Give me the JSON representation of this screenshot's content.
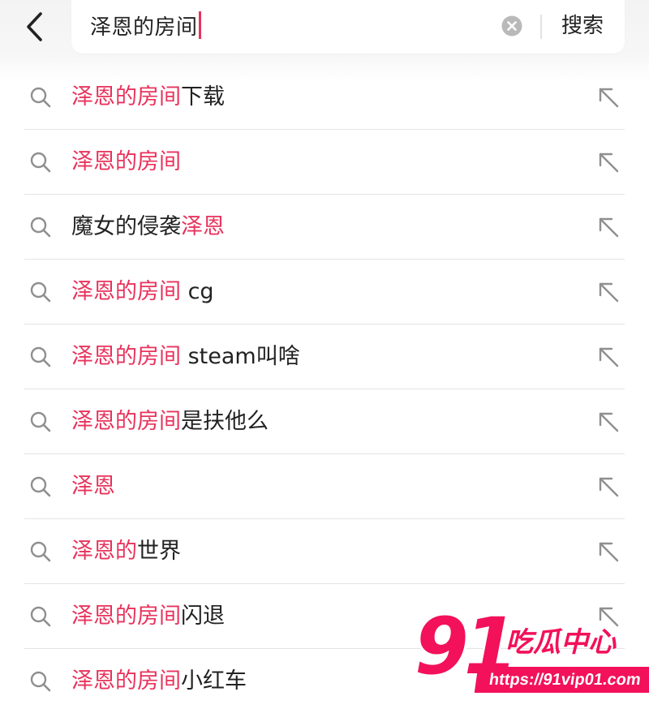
{
  "header": {
    "back_icon": "chevron-left-icon",
    "search": {
      "value": "泽恩的房间",
      "clear_icon": "clear-circle-icon"
    },
    "search_button_label": "搜索"
  },
  "colors": {
    "highlight": "#e8335c",
    "text": "#222222",
    "icon": "#8f8f8f",
    "watermark": "#f2115a"
  },
  "suggestions": [
    {
      "highlight": "泽恩的房间",
      "rest": "下载",
      "prefix": ""
    },
    {
      "highlight": "泽恩的房间",
      "rest": "",
      "prefix": ""
    },
    {
      "prefix": "魔女的侵袭",
      "highlight": "泽恩",
      "rest": ""
    },
    {
      "highlight": "泽恩的房间",
      "rest": " cg",
      "prefix": ""
    },
    {
      "highlight": "泽恩的房间",
      "rest": " steam叫啥",
      "prefix": ""
    },
    {
      "highlight": "泽恩的房间",
      "rest": "是扶他么",
      "prefix": ""
    },
    {
      "highlight": "泽恩",
      "rest": "",
      "prefix": ""
    },
    {
      "highlight": "泽恩的",
      "rest": "世界",
      "prefix": ""
    },
    {
      "highlight": "泽恩的房间",
      "rest": "闪退",
      "prefix": ""
    },
    {
      "highlight": "泽恩的房间",
      "rest": "小红车",
      "prefix": ""
    }
  ],
  "row_icons": {
    "leading": "search-icon",
    "trailing": "fill-query-arrow-icon"
  },
  "watermark": {
    "number": "91",
    "title": "吃瓜中心",
    "url": "https://91vip01.com"
  }
}
